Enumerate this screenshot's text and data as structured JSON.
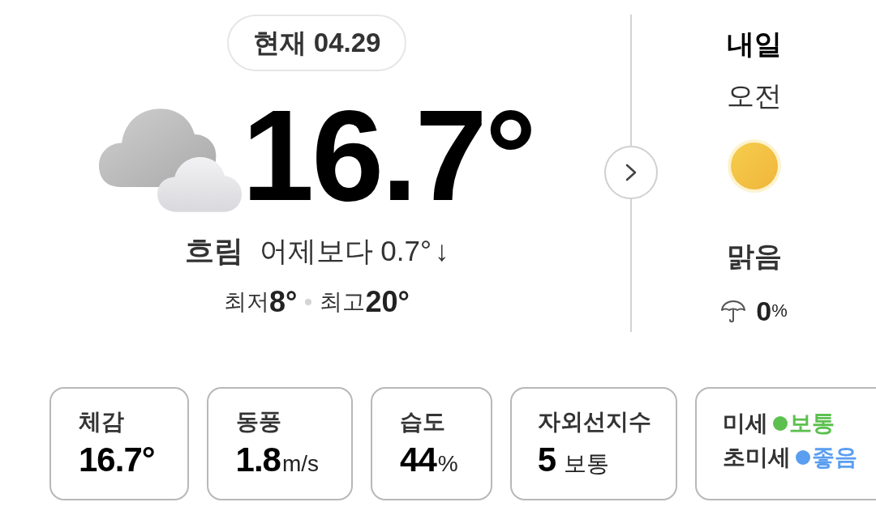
{
  "current": {
    "badge": "현재 04.29",
    "temperature": "16.7°",
    "condition": "흐림",
    "comparison": "어제보다 0.7°",
    "trend_arrow": "↓",
    "low": {
      "label": "최저",
      "value": "8°"
    },
    "high": {
      "label": "최고",
      "value": "20°"
    }
  },
  "tomorrow": {
    "title": "내일",
    "period": "오전",
    "condition": "맑음",
    "precipitation": {
      "value": "0",
      "unit": "%"
    }
  },
  "details": [
    {
      "kind": "stat",
      "label": "체감",
      "value": "16.7°"
    },
    {
      "kind": "stat",
      "label": "동풍",
      "value": "1.8",
      "suffix": "m/s"
    },
    {
      "kind": "stat",
      "label": "습도",
      "value": "44",
      "suffix": "%"
    },
    {
      "kind": "grade",
      "label": "자외선지수",
      "value": "5",
      "suffix": "보통"
    },
    {
      "kind": "air",
      "items": [
        {
          "label": "미세",
          "status": "보통",
          "color": "#5cc04f"
        },
        {
          "label": "초미세",
          "status": "좋음",
          "color": "#5a9ef0"
        }
      ]
    }
  ]
}
